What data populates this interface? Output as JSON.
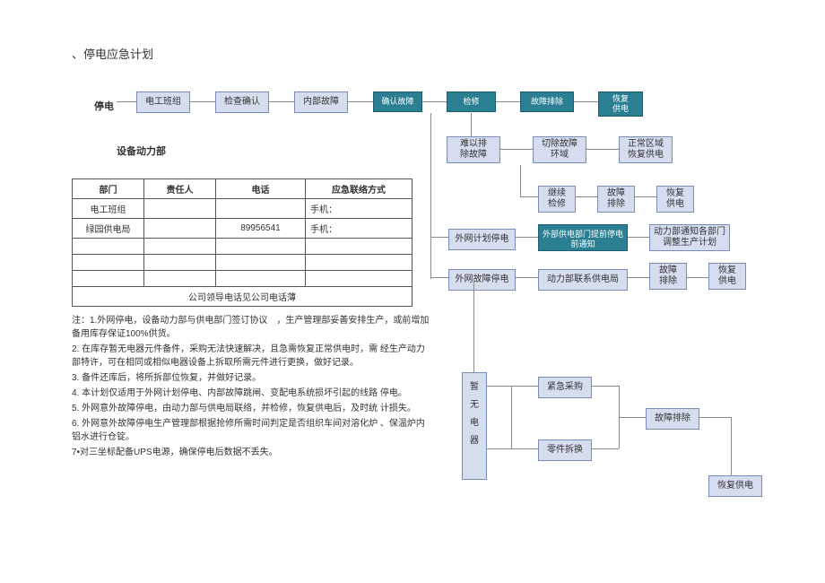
{
  "title": "、停电应急计划",
  "row1": {
    "stop": "停电",
    "team": "电工班组",
    "check": "检查确认",
    "internal": "内部故障",
    "confirm": "确认故障",
    "repair": "检修",
    "remove": "故障排除",
    "restore1": "恢复",
    "restore2": "供电"
  },
  "subhead": "设备动力部",
  "row2": {
    "hard1": "难以排",
    "hard2": "除故障",
    "cut1": "切除故障",
    "cut2": "环域",
    "normal1": "正常区域",
    "normal2": "恢复供电"
  },
  "row3": {
    "cont1": "继续",
    "cont2": "检修",
    "fault1": "故障",
    "fault2": "排除",
    "rest1": "恢复",
    "rest2": "供电"
  },
  "row4": {
    "plan": "外网计划停电",
    "teal": "外部供电部门提前停电前通知",
    "dept1": "动力部通知各部门",
    "dept2": "调整生产计划"
  },
  "row5": {
    "ext": "外网故障停电",
    "contact": "动力部联系供电局",
    "fault1": "故障",
    "fault2": "排除",
    "rest1": "恢复",
    "rest2": "供电"
  },
  "rightcol": {
    "na1": "暂",
    "na2": "无",
    "na3": "电",
    "na4": "器",
    "buy": "紧急采购",
    "swap": "零件拆换",
    "remove": "故障排除",
    "restore": "恢复供电"
  },
  "table": {
    "h1": "部门",
    "h2": "责任人",
    "h3": "电话",
    "h4": "应急联络方式",
    "r1c1": "电工班组",
    "r1c4": "手机：",
    "r2c1": "绿园供电局",
    "r2c3": "89956541",
    "r2c4": "手机：",
    "footer": "公司领导电话见公司电话薄"
  },
  "notes": {
    "n1": "注：1.外网停电，设备动力部与供电部门签订协议　，生产管理部妥善安排生产，或前增加备用库存保证100%供货。",
    "n2": "2. 在库存暂无电器元件备件，采购无法快速解决，且急需恢复正常供电时，需 经生产动力部特许，可在相同或相似电器设备上拆取所需元件进行更换，做好记录。",
    "n3": "3. 备件还库后，将所拆部位恢复，并做好记录。",
    "n4": "4. 本计划仅适用于外网计划停电、内部故障跳闸、变配电系统损坏引起的线路 停电。",
    "n5": "5. 外网意外故障停电，由动力部与供电局联络，并检修，恢复供电后，及时统 计损失。",
    "n6": "6. 外网意外故障停电生产管理部根据抢修所需时间判定是否组织车间对溶化炉 、保温炉内铝水进行仓锭。",
    "n7": "7•对三坐标配备UPS电源，确保停电后数据不丢失。"
  }
}
